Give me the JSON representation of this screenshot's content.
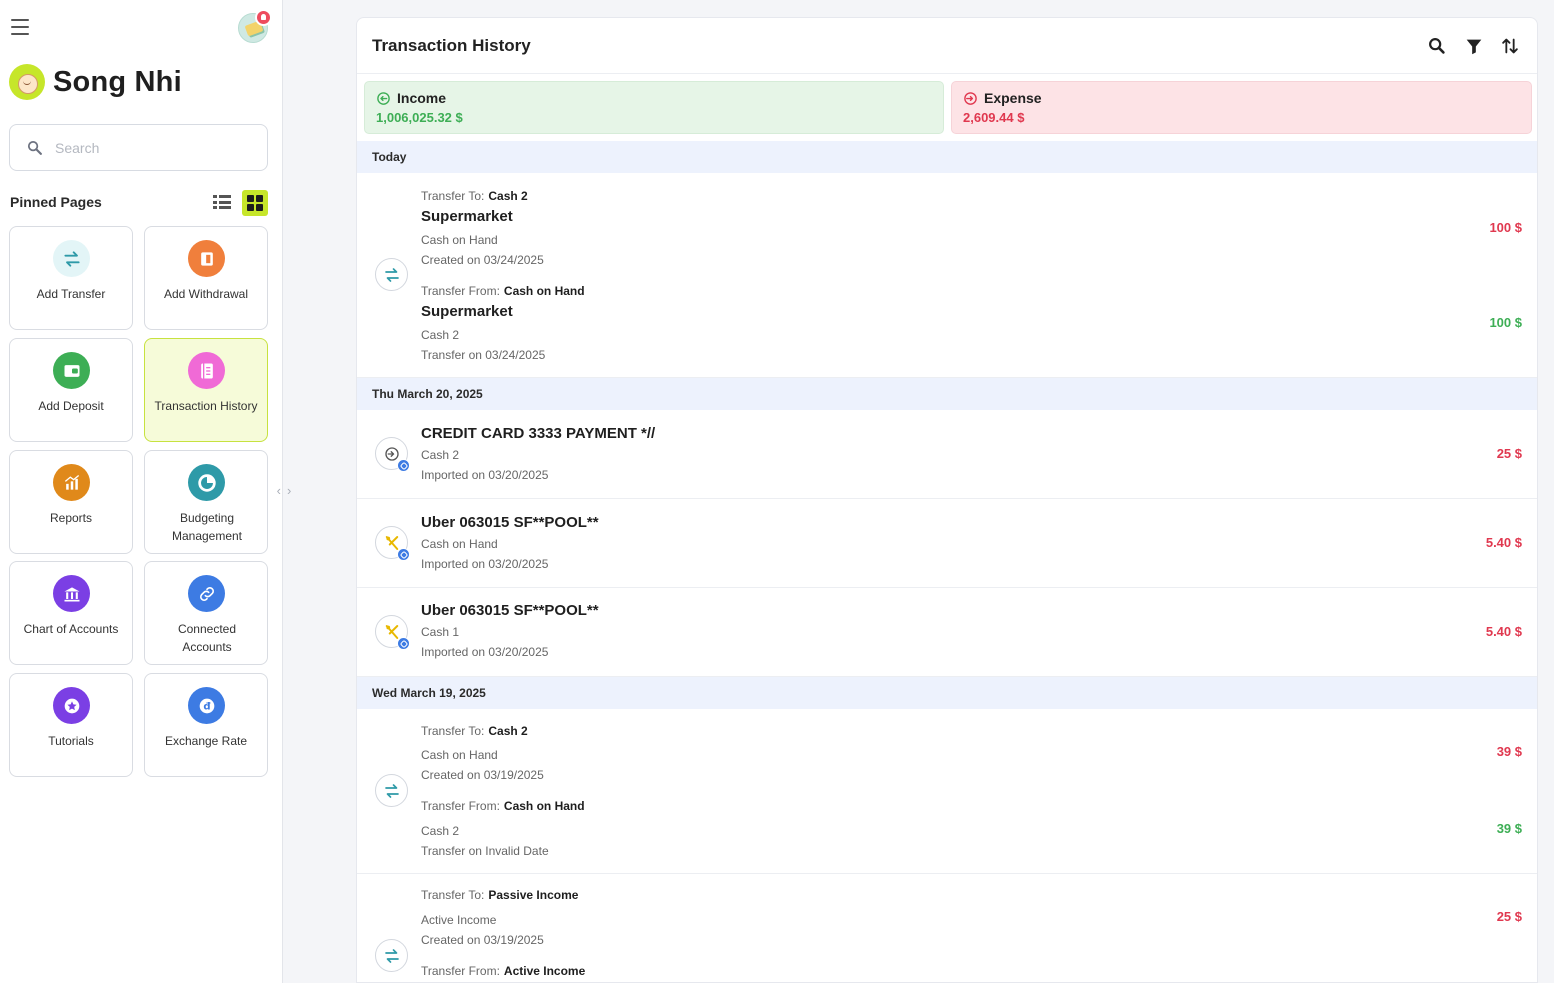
{
  "sidebar": {
    "user_name": "Song Nhi",
    "search_placeholder": "Search",
    "pinned_title": "Pinned Pages",
    "tiles": [
      {
        "label": "Add Transfer",
        "icon": "transfer-icon",
        "color": "#e3f5f7"
      },
      {
        "label": "Add Withdrawal",
        "icon": "withdrawal-icon",
        "color": "#f07f3c"
      },
      {
        "label": "Add Deposit",
        "icon": "wallet-icon",
        "color": "#3dae55"
      },
      {
        "label": "Transaction History",
        "icon": "ledger-icon",
        "color": "#f06ad6"
      },
      {
        "label": "Reports",
        "icon": "chart-bars-icon",
        "color": "#e0891a"
      },
      {
        "label": "Budgeting Management",
        "icon": "pie-icon",
        "color": "#2e9aa8"
      },
      {
        "label": "Chart of Accounts",
        "icon": "bank-icon",
        "color": "#7b3fe4"
      },
      {
        "label": "Connected Accounts",
        "icon": "link-icon",
        "color": "#3d7be3"
      },
      {
        "label": "Tutorials",
        "icon": "star-badge-icon",
        "color": "#7b3fe4"
      },
      {
        "label": "Exchange Rate",
        "icon": "currency-dong-icon",
        "color": "#3d7be3"
      }
    ]
  },
  "main": {
    "title": "Transaction History",
    "income": {
      "label": "Income",
      "value": "1,006,025.32 $",
      "color": "#3dae55"
    },
    "expense": {
      "label": "Expense",
      "value": "2,609.44 $",
      "color": "#e0384f"
    },
    "groups": [
      {
        "date": "Today",
        "items": [
          {
            "kind": "transfer",
            "to_label": "Transfer To:",
            "to_value": "Cash 2",
            "name1": "Supermarket",
            "account1": "Cash on Hand",
            "date1": "Created on 03/24/2025",
            "amount1": "100 $",
            "from_label": "Transfer From:",
            "from_value": "Cash on Hand",
            "name2": "Supermarket",
            "account2": "Cash 2",
            "date2": "Transfer on 03/24/2025",
            "amount2": "100 $"
          }
        ]
      },
      {
        "date": "Thu March 20, 2025",
        "items": [
          {
            "kind": "payment",
            "name": "CREDIT CARD 3333 PAYMENT *//",
            "account": "Cash 2",
            "date": "Imported on 03/20/2025",
            "amount": "25 $"
          },
          {
            "kind": "food",
            "name": "Uber 063015 SF**POOL**",
            "account": "Cash on Hand",
            "date": "Imported on 03/20/2025",
            "amount": "5.40 $"
          },
          {
            "kind": "food",
            "name": "Uber 063015 SF**POOL**",
            "account": "Cash 1",
            "date": "Imported on 03/20/2025",
            "amount": "5.40 $"
          }
        ]
      },
      {
        "date": "Wed March 19, 2025",
        "items": [
          {
            "kind": "transfer",
            "to_label": "Transfer To:",
            "to_value": "Cash 2",
            "account1": "Cash on Hand",
            "date1": "Created on 03/19/2025",
            "amount1": "39 $",
            "from_label": "Transfer From:",
            "from_value": "Cash on Hand",
            "account2": "Cash 2",
            "date2": "Transfer on Invalid Date",
            "amount2": "39 $"
          },
          {
            "kind": "transfer",
            "to_label": "Transfer To:",
            "to_value": "Passive Income",
            "account1": "Active Income",
            "date1": "Created on 03/19/2025",
            "amount1": "25 $",
            "from_label": "Transfer From:",
            "from_value": "Active Income"
          }
        ]
      }
    ]
  }
}
